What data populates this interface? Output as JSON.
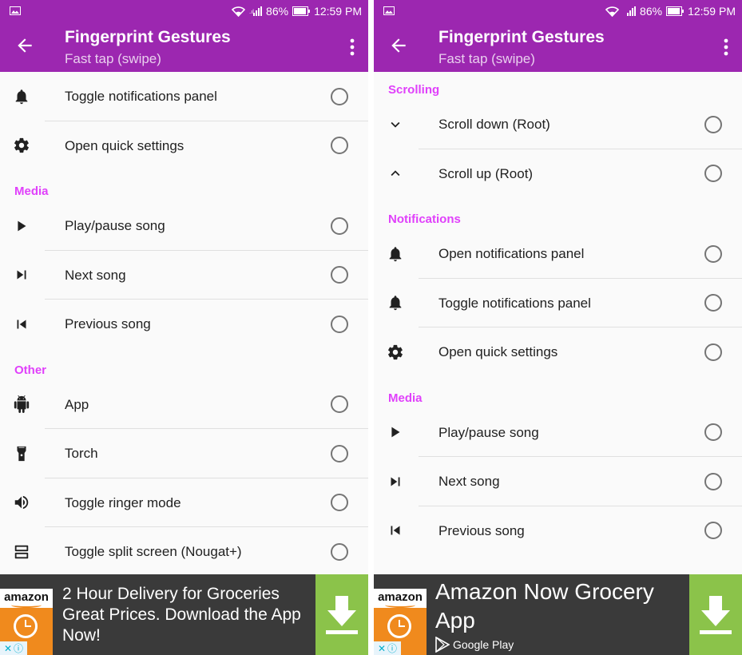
{
  "status_bar": {
    "battery": "86%",
    "time": "12:59 PM"
  },
  "app_bar": {
    "title": "Fingerprint Gestures",
    "subtitle": "Fast tap (swipe)"
  },
  "left_list": {
    "items_a": [
      {
        "label": "Toggle notifications panel",
        "icon": "bell-icon"
      },
      {
        "label": "Open quick settings",
        "icon": "gear-icon"
      }
    ],
    "media_header": "Media",
    "media": [
      {
        "label": "Play/pause song",
        "icon": "play-icon"
      },
      {
        "label": "Next song",
        "icon": "skip-next-icon"
      },
      {
        "label": "Previous song",
        "icon": "skip-previous-icon"
      }
    ],
    "other_header": "Other",
    "other": [
      {
        "label": "App",
        "icon": "android-icon"
      },
      {
        "label": "Torch",
        "icon": "flashlight-icon"
      },
      {
        "label": "Toggle ringer mode",
        "icon": "volume-icon"
      },
      {
        "label": "Toggle split screen (Nougat+)",
        "icon": "split-screen-icon"
      }
    ]
  },
  "right_list": {
    "scrolling_header": "Scrolling",
    "scrolling": [
      {
        "label": "Scroll down (Root)",
        "icon": "chevron-down-icon"
      },
      {
        "label": "Scroll up (Root)",
        "icon": "chevron-up-icon"
      }
    ],
    "notifications_header": "Notifications",
    "notifications": [
      {
        "label": "Open notifications panel",
        "icon": "bell-icon"
      },
      {
        "label": "Toggle notifications panel",
        "icon": "bell-icon"
      },
      {
        "label": "Open quick settings",
        "icon": "gear-icon"
      }
    ],
    "media_header": "Media",
    "media": [
      {
        "label": "Play/pause song",
        "icon": "play-icon"
      },
      {
        "label": "Next song",
        "icon": "skip-next-icon"
      },
      {
        "label": "Previous song",
        "icon": "skip-previous-icon"
      }
    ]
  },
  "ads": {
    "logo_text": "amazon",
    "left_text": "2 Hour Delivery for Groceries Great Prices. Download the App Now!",
    "right_title": "Amazon Now Grocery App",
    "right_store": "Google Play"
  },
  "colors": {
    "app_bar": "#9c27b0",
    "section_header": "#e040fb",
    "ad_background": "#3a3a3a",
    "download_button": "#8bc34a",
    "amazon_orange": "#f08a1d"
  }
}
